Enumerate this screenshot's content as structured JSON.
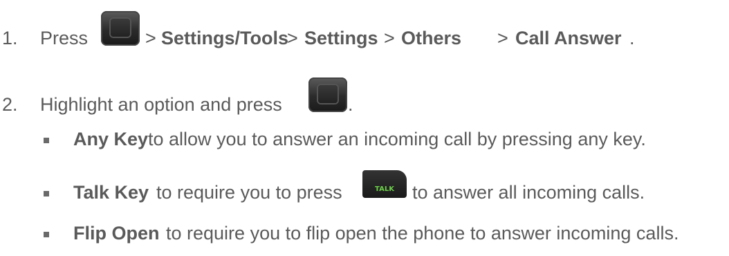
{
  "steps": [
    {
      "number": "1.",
      "parts": [
        "Press",
        ">",
        "Settings/Tools",
        ">",
        "Settings",
        ">",
        "Others",
        ">",
        "Call Answer",
        "."
      ]
    },
    {
      "number": "2.",
      "parts": [
        "Highlight an option and press",
        "."
      ]
    }
  ],
  "options": [
    {
      "name": "Any Key",
      "desc": "to allow you to answer an incoming call by pressing any key."
    },
    {
      "name": "Talk Key",
      "desc_before": "to require you to press",
      "desc_after": "to answer all incoming calls."
    },
    {
      "name": "Flip Open",
      "desc": "to require you to flip open the phone to answer incoming calls."
    }
  ],
  "keys": {
    "ok_key_icon": "menu-ok-key-icon",
    "talk_key_label": "TALK",
    "talk_key_color": "#6ccf4a"
  }
}
